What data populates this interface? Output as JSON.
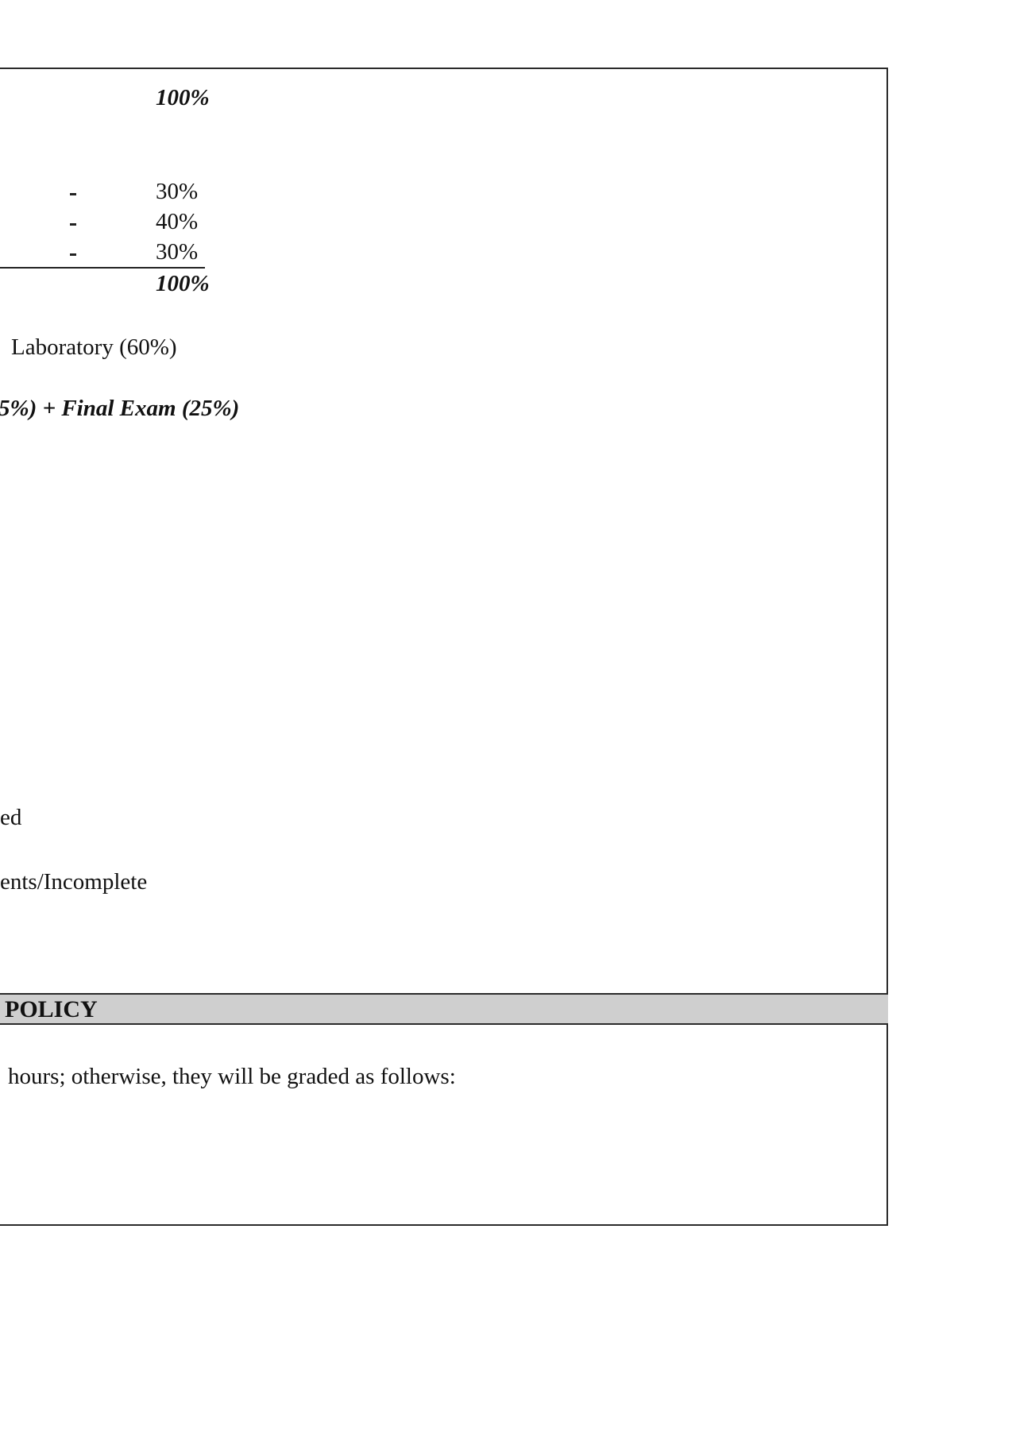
{
  "grading": {
    "total_top": "100%",
    "components": [
      {
        "value": "30%"
      },
      {
        "value": "40%"
      },
      {
        "value": "30%"
      }
    ],
    "dash": "-",
    "total_bottom": "100%",
    "formula_lab": "Laboratory (60%)",
    "formula_final": "5%) + Final Exam (25%)"
  },
  "remarks": {
    "line1": "ed",
    "line2": "ents/Incomplete"
  },
  "policy": {
    "title": "POLICY",
    "body": "hours; otherwise, they will be graded as follows:"
  }
}
